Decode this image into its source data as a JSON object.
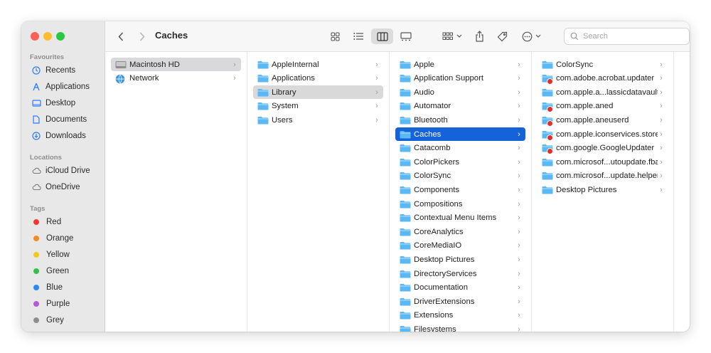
{
  "window": {
    "title": "Caches"
  },
  "sidebar": {
    "favourites_label": "Favourites",
    "favourites": [
      {
        "label": "Recents",
        "icon": "clock-icon"
      },
      {
        "label": "Applications",
        "icon": "applications-icon"
      },
      {
        "label": "Desktop",
        "icon": "desktop-icon"
      },
      {
        "label": "Documents",
        "icon": "document-icon"
      },
      {
        "label": "Downloads",
        "icon": "download-icon"
      }
    ],
    "locations_label": "Locations",
    "locations": [
      {
        "label": "iCloud Drive",
        "icon": "cloud-icon"
      },
      {
        "label": "OneDrive",
        "icon": "cloud-icon"
      }
    ],
    "tags_label": "Tags",
    "tags": [
      {
        "label": "Red",
        "color": "#f03b35"
      },
      {
        "label": "Orange",
        "color": "#f38c1f"
      },
      {
        "label": "Yellow",
        "color": "#f4c81a"
      },
      {
        "label": "Green",
        "color": "#35c048"
      },
      {
        "label": "Blue",
        "color": "#2a86f7"
      },
      {
        "label": "Purple",
        "color": "#b35bd4"
      },
      {
        "label": "Grey",
        "color": "#8e8e92"
      }
    ]
  },
  "toolbar": {
    "search_placeholder": "Search"
  },
  "columns": [
    [
      {
        "label": "Macintosh HD",
        "icon": "hard-drive-icon",
        "selected": "grey"
      },
      {
        "label": "Network",
        "icon": "network-icon"
      }
    ],
    [
      {
        "label": "AppleInternal"
      },
      {
        "label": "Applications"
      },
      {
        "label": "Library",
        "selected": "grey"
      },
      {
        "label": "System"
      },
      {
        "label": "Users"
      }
    ],
    [
      {
        "label": "Apple"
      },
      {
        "label": "Application Support"
      },
      {
        "label": "Audio"
      },
      {
        "label": "Automator"
      },
      {
        "label": "Bluetooth"
      },
      {
        "label": "Caches",
        "selected": "blue"
      },
      {
        "label": "Catacomb"
      },
      {
        "label": "ColorPickers"
      },
      {
        "label": "ColorSync"
      },
      {
        "label": "Components"
      },
      {
        "label": "Compositions"
      },
      {
        "label": "Contextual Menu Items"
      },
      {
        "label": "CoreAnalytics"
      },
      {
        "label": "CoreMediaIO"
      },
      {
        "label": "Desktop Pictures"
      },
      {
        "label": "DirectoryServices"
      },
      {
        "label": "Documentation"
      },
      {
        "label": "DriverExtensions"
      },
      {
        "label": "Extensions"
      },
      {
        "label": "Filesystems"
      }
    ],
    [
      {
        "label": "ColorSync"
      },
      {
        "label": "com.adobe.acrobat.updater",
        "restricted": true
      },
      {
        "label": "com.apple.a...lassicdatavault"
      },
      {
        "label": "com.apple.aned",
        "restricted": true
      },
      {
        "label": "com.apple.aneuserd",
        "restricted": true
      },
      {
        "label": "com.apple.iconservices.store",
        "restricted": true
      },
      {
        "label": "com.google.GoogleUpdater",
        "restricted": true
      },
      {
        "label": "com.microsof...utoupdate.fba"
      },
      {
        "label": "com.microsof...update.helper"
      },
      {
        "label": "Desktop Pictures"
      }
    ]
  ],
  "colors": {
    "accent": "#1662d8",
    "folder": "#5ab8f4"
  }
}
